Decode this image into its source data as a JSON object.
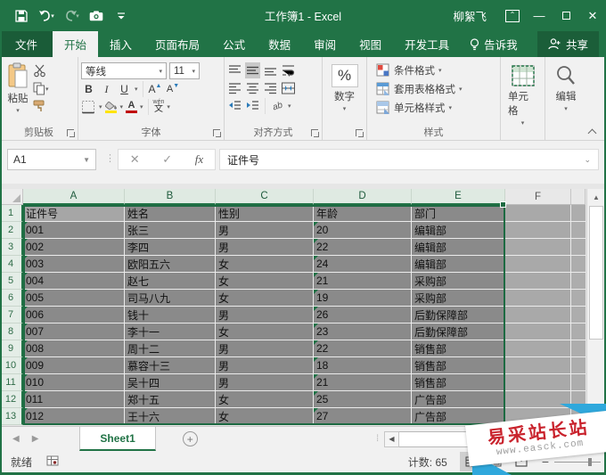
{
  "window": {
    "title": "工作簿1 - Excel",
    "user": "柳絮飞"
  },
  "tabs": {
    "file": "文件",
    "items": [
      "开始",
      "插入",
      "页面布局",
      "公式",
      "数据",
      "审阅",
      "视图",
      "开发工具"
    ],
    "active_index": 0,
    "tell_me": "告诉我",
    "share": "共享"
  },
  "ribbon": {
    "clipboard": {
      "paste": "粘贴",
      "label": "剪贴板"
    },
    "font": {
      "name": "等线",
      "size": "11",
      "bold": "B",
      "italic": "I",
      "underline": "U",
      "grow": "A",
      "shrink": "A",
      "color_letter": "A",
      "pinyin_top": "wén",
      "pinyin_bottom": "文",
      "label": "字体"
    },
    "alignment": {
      "ab": "ab",
      "label": "对齐方式"
    },
    "number": {
      "percent": "%",
      "label": "数字"
    },
    "styles": {
      "conditional": "条件格式",
      "format_table": "套用表格格式",
      "cell_styles": "单元格样式",
      "label": "样式"
    },
    "cells": {
      "label": "单元格"
    },
    "editing": {
      "label": "编辑"
    }
  },
  "formula_bar": {
    "name_box": "A1",
    "fx": "fx",
    "content": "证件号"
  },
  "sheet": {
    "columns": [
      "A",
      "B",
      "C",
      "D",
      "E",
      "F"
    ],
    "selected_column_count": 5,
    "rows": [
      {
        "num": "1",
        "cells": [
          "证件号",
          "姓名",
          "性别",
          "年龄",
          "部门"
        ]
      },
      {
        "num": "2",
        "cells": [
          "001",
          "张三",
          "男",
          "20",
          "编辑部"
        ]
      },
      {
        "num": "3",
        "cells": [
          "002",
          "李四",
          "男",
          "22",
          "编辑部"
        ]
      },
      {
        "num": "4",
        "cells": [
          "003",
          "欧阳五六",
          "女",
          "24",
          "编辑部"
        ]
      },
      {
        "num": "5",
        "cells": [
          "004",
          "赵七",
          "女",
          "21",
          "采购部"
        ]
      },
      {
        "num": "6",
        "cells": [
          "005",
          "司马八九",
          "女",
          "19",
          "采购部"
        ]
      },
      {
        "num": "7",
        "cells": [
          "006",
          "钱十",
          "男",
          "26",
          "后勤保障部"
        ]
      },
      {
        "num": "8",
        "cells": [
          "007",
          "李十一",
          "女",
          "23",
          "后勤保障部"
        ]
      },
      {
        "num": "9",
        "cells": [
          "008",
          "周十二",
          "男",
          "22",
          "销售部"
        ]
      },
      {
        "num": "10",
        "cells": [
          "009",
          "慕容十三",
          "男",
          "18",
          "销售部"
        ]
      },
      {
        "num": "11",
        "cells": [
          "010",
          "吴十四",
          "男",
          "21",
          "销售部"
        ]
      },
      {
        "num": "12",
        "cells": [
          "011",
          "郑十五",
          "女",
          "25",
          "广告部"
        ]
      },
      {
        "num": "13",
        "cells": [
          "012",
          "王十六",
          "女",
          "27",
          "广告部"
        ]
      }
    ],
    "error_marker_columns": [
      0,
      3
    ]
  },
  "sheet_tabs": {
    "active": "Sheet1"
  },
  "status_bar": {
    "ready": "就绪",
    "count": "计数: 65"
  },
  "watermark": {
    "title": "易采站长站",
    "url": "www.easck.com"
  },
  "colors": {
    "accent": "#217346",
    "selection_fill": "#8a8a8a",
    "watermark_red": "#c9232d",
    "watermark_cyan": "#2fa8dc"
  }
}
